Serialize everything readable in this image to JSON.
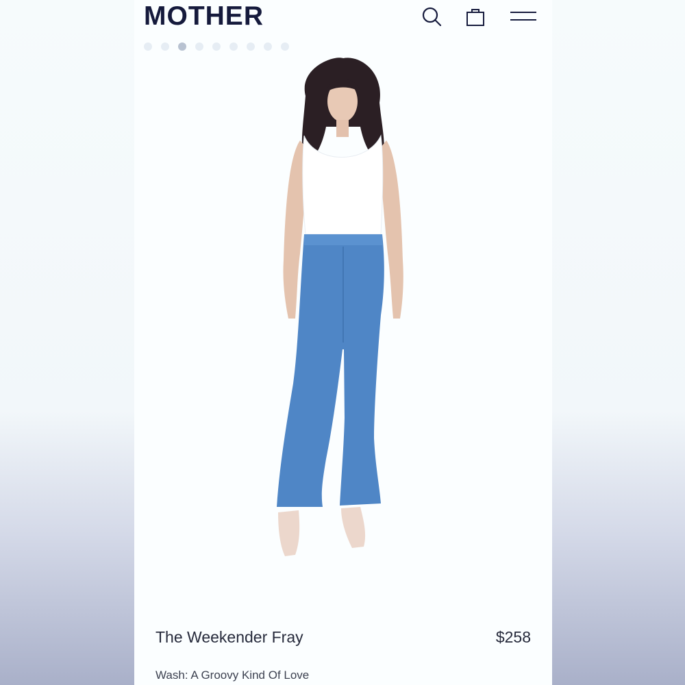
{
  "header": {
    "logo": "MOTHER",
    "icons": [
      "search-icon",
      "shopping-bag-icon",
      "menu-icon"
    ]
  },
  "carousel": {
    "total": 9,
    "active_index": 2
  },
  "product": {
    "name": "The Weekender Fray",
    "price": "$258",
    "wash": "Wash: A Groovy Kind Of Love"
  },
  "colors": {
    "brand": "#151a3c",
    "denim": "#4f86c6",
    "top": "#ffffff"
  }
}
